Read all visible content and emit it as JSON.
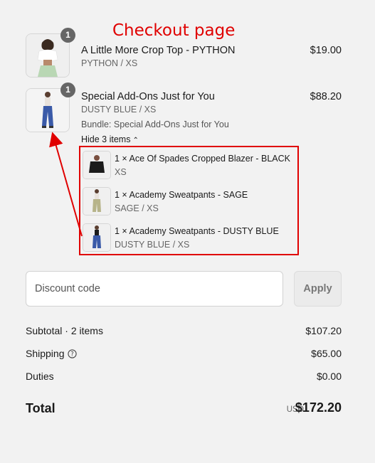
{
  "annotation": {
    "title": "Checkout page",
    "color": "#e00000"
  },
  "line_items": [
    {
      "quantity": "1",
      "title": "A Little More Crop Top - PYTHON",
      "variant": "PYTHON / XS",
      "price": "$19.00"
    },
    {
      "quantity": "1",
      "title": "Special Add-Ons Just for You",
      "variant": "DUSTY BLUE / XS",
      "bundle_text": "Bundle: Special Add-Ons Just for You",
      "price": "$88.20",
      "toggle_label": "Hide 3 items",
      "bundle_items": [
        {
          "title": "1 × Ace Of Spades Cropped Blazer - BLACK",
          "variant": "XS"
        },
        {
          "title": "1 × Academy Sweatpants - SAGE",
          "variant": "SAGE / XS"
        },
        {
          "title": "1 × Academy Sweatpants - DUSTY BLUE",
          "variant": "DUSTY BLUE / XS"
        }
      ]
    }
  ],
  "discount": {
    "placeholder": "Discount code",
    "apply_label": "Apply"
  },
  "summary": {
    "subtotal_label": "Subtotal · 2 items",
    "subtotal_value": "$107.20",
    "shipping_label": "Shipping",
    "shipping_value": "$65.00",
    "duties_label": "Duties",
    "duties_value": "$0.00",
    "total_label": "Total",
    "total_currency": "USD",
    "total_value": "$172.20"
  },
  "colors": {
    "background": "#f2f2f2",
    "highlight_red": "#e00000",
    "badge": "#666666"
  },
  "icons": [
    "chevron-up-icon",
    "question-circle-icon",
    "annotation-arrow"
  ]
}
